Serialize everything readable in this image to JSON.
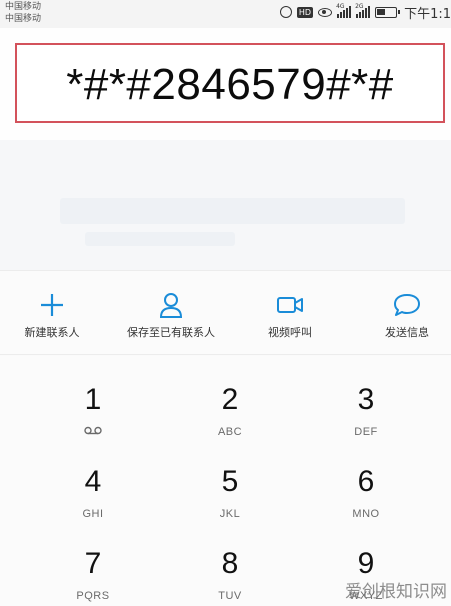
{
  "status_bar": {
    "carrier_1": "中国移动",
    "carrier_2": "中国移动",
    "hd_label": "HD",
    "signal_1_tag": "4G",
    "signal_2_tag": "2G",
    "time": "下午1:1",
    "icons": [
      "alarm-icon",
      "hd-icon",
      "eye-icon",
      "signal-icon",
      "signal-icon",
      "battery-icon"
    ]
  },
  "dialer": {
    "number": "*#*#2846579#*#",
    "highlight_color": "#d3525b"
  },
  "actions": [
    {
      "label": "新建联系人",
      "icon": "plus-icon"
    },
    {
      "label": "保存至已有联系人",
      "icon": "person-icon"
    },
    {
      "label": "视频呼叫",
      "icon": "video-camera-icon"
    },
    {
      "label": "发送信息",
      "icon": "chat-bubble-icon"
    }
  ],
  "accent_color": "#1a8cd8",
  "keypad": [
    {
      "digit": "1",
      "letters": "",
      "icon": "voicemail-icon"
    },
    {
      "digit": "2",
      "letters": "ABC"
    },
    {
      "digit": "3",
      "letters": "DEF"
    },
    {
      "digit": "4",
      "letters": "GHI"
    },
    {
      "digit": "5",
      "letters": "JKL"
    },
    {
      "digit": "6",
      "letters": "MNO"
    },
    {
      "digit": "7",
      "letters": "PQRS"
    },
    {
      "digit": "8",
      "letters": "TUV"
    },
    {
      "digit": "9",
      "letters": "WXYZ"
    }
  ],
  "watermark": "爱创根知识网"
}
